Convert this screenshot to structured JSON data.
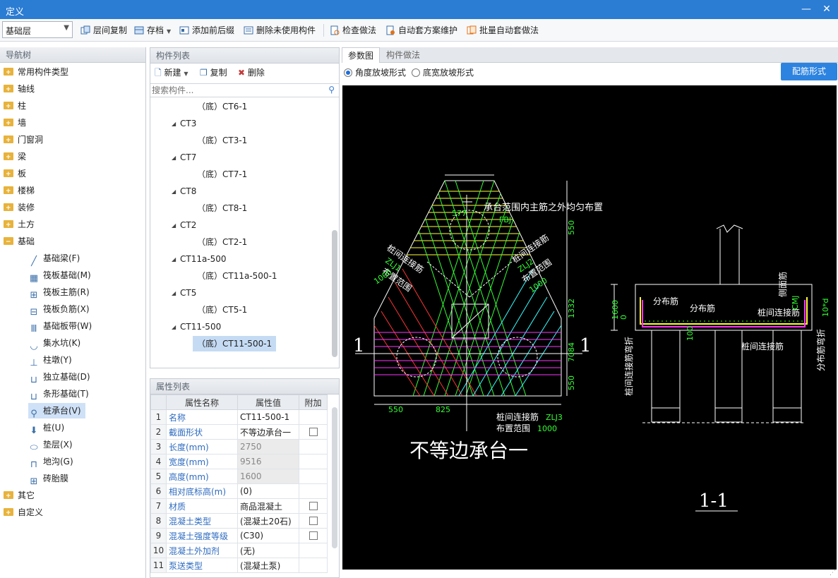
{
  "window": {
    "title": "定义"
  },
  "toolbar": {
    "layer_value": "基础层",
    "items": [
      {
        "label": "层间复制"
      },
      {
        "label": "存档"
      },
      {
        "label": "添加前后缀"
      },
      {
        "label": "删除未使用构件"
      },
      {
        "label": "检查做法"
      },
      {
        "label": "自动套方案维护"
      },
      {
        "label": "批量自动套做法"
      }
    ]
  },
  "nav": {
    "title": "导航树",
    "folders_top": [
      "常用构件类型",
      "轴线",
      "柱",
      "墙",
      "门窗洞",
      "梁",
      "板",
      "楼梯",
      "装修",
      "土方",
      "基础"
    ],
    "sub_items": [
      "基础梁(F)",
      "筏板基础(M)",
      "筏板主筋(R)",
      "筏板负筋(X)",
      "基础板带(W)",
      "集水坑(K)",
      "柱墩(Y)",
      "独立基础(D)",
      "条形基础(T)",
      "桩承台(V)",
      "桩(U)",
      "垫层(X)",
      "地沟(G)",
      "砖胎膜"
    ],
    "folders_bottom": [
      "其它",
      "自定义"
    ]
  },
  "component_list": {
    "title": "构件列表",
    "new_label": "新建",
    "copy_label": "复制",
    "delete_label": "删除",
    "search_placeholder": "搜索构件...",
    "rows": [
      {
        "text": "（底）CT6-1",
        "level": 2
      },
      {
        "text": "CT3",
        "level": 1
      },
      {
        "text": "（底）CT3-1",
        "level": 2
      },
      {
        "text": "CT7",
        "level": 1
      },
      {
        "text": "（底）CT7-1",
        "level": 2
      },
      {
        "text": "CT8",
        "level": 1
      },
      {
        "text": "（底）CT8-1",
        "level": 2
      },
      {
        "text": "CT2",
        "level": 1
      },
      {
        "text": "（底）CT2-1",
        "level": 2
      },
      {
        "text": "CT11a-500",
        "level": 1
      },
      {
        "text": "（底）CT11a-500-1",
        "level": 2
      },
      {
        "text": "CT5",
        "level": 1
      },
      {
        "text": "（底）CT5-1",
        "level": 2
      },
      {
        "text": "CT11-500",
        "level": 1
      },
      {
        "text": "（底）CT11-500-1",
        "level": 2
      }
    ]
  },
  "props": {
    "title": "属性列表",
    "col_name": "属性名称",
    "col_value": "属性值",
    "col_extra": "附加",
    "rows": [
      {
        "num": "1",
        "name": "名称",
        "value": "CT11-500-1"
      },
      {
        "num": "2",
        "name": "截面形状",
        "value": "不等边承台一"
      },
      {
        "num": "3",
        "name": "长度(mm)",
        "value": "2750"
      },
      {
        "num": "4",
        "name": "宽度(mm)",
        "value": "9516"
      },
      {
        "num": "5",
        "name": "高度(mm)",
        "value": "1600"
      },
      {
        "num": "6",
        "name": "相对底标高(m)",
        "value": "(0)"
      },
      {
        "num": "7",
        "name": "材质",
        "value": "商品混凝土"
      },
      {
        "num": "8",
        "name": "混凝土类型",
        "value": "(混凝土20石)"
      },
      {
        "num": "9",
        "name": "混凝土强度等级",
        "value": "(C30)"
      },
      {
        "num": "10",
        "name": "混凝土外加剂",
        "value": "(无)"
      },
      {
        "num": "11",
        "name": "泵送类型",
        "value": "(混凝土泵)"
      }
    ]
  },
  "right": {
    "tab_params": "参数图",
    "tab_method": "构件做法",
    "radio_angle": "角度放坡形式",
    "radio_width": "底宽放坡形式",
    "rebar_button": "配筋形式"
  },
  "drawing": {
    "top_note": "承台范围内主筋之外均匀布置",
    "fbj": "FBJ",
    "pile_link_left": "桩间连接筋",
    "zlj1": "ZLJ1",
    "layout_range_l": "布置范围",
    "val_1000_l": "1000",
    "pile_link_right": "桩间连接筋",
    "zlj2": "ZLJ2",
    "layout_range_r": "布置范围",
    "val_1000_r": "1000",
    "dim_577": "577",
    "dim_550_top": "550",
    "dim_1332": "1332",
    "dim_7084": "7084",
    "dim_550_bot": "550",
    "dim_550_h": "550",
    "dim_825": "825",
    "mark_left": "1",
    "mark_right": "1",
    "zlj3_label": "桩间连接筋",
    "zlj3": "ZLJ3",
    "layout_range_b": "布置范围",
    "val_1000_b": "1000",
    "shape_title": "不等边承台一",
    "section_title": "1-1",
    "dist_bar_1": "分布筋",
    "dist_bar_2": "分布筋",
    "pile_link_sec": "桩间连接筋",
    "pile_link_sec2": "桩间连接筋",
    "side_bar": "侧面筋",
    "cmj": "CMJ",
    "dim_1600": "1600",
    "dim_0": "0",
    "dim_100": "100",
    "ten_d": "10*d",
    "bend_left": "桩间连接筋弯折",
    "bend_right": "分布筋弯折"
  },
  "colors": {
    "titlebar": "#2b7cd3",
    "accent_button": "#2d83e0",
    "cad_bg": "#000000",
    "cad_green": "#33ff33",
    "cad_yellow": "#ffff33",
    "cad_magenta": "#ff33ff",
    "cad_cyan": "#33ffff",
    "cad_red": "#ff3333"
  }
}
